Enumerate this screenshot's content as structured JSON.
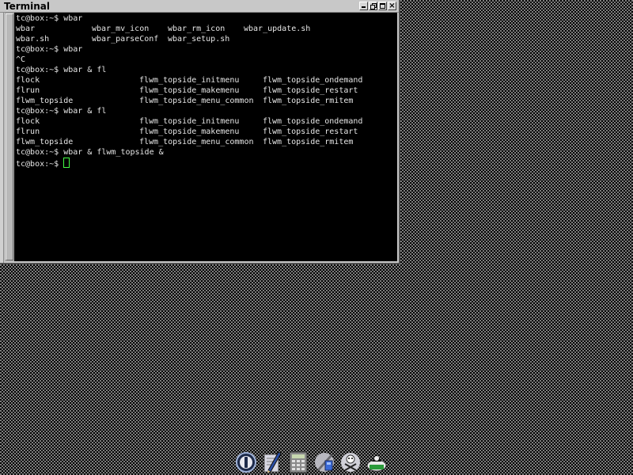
{
  "window": {
    "title": "Terminal",
    "buttons": {
      "minimize": "minimize",
      "maximize": "maximize",
      "restore": "restore",
      "close": "×"
    }
  },
  "terminal": {
    "lines": [
      {
        "type": "text",
        "text": "tc@box:~$ wbar"
      },
      {
        "type": "cols4",
        "c0": "wbar",
        "c1": "wbar_mv_icon",
        "c2": "wbar_rm_icon",
        "c3": "wbar_update.sh"
      },
      {
        "type": "cols3",
        "c0": "wbar.sh",
        "c1": "wbar_parseConf",
        "c2": "wbar_setup.sh"
      },
      {
        "type": "text",
        "text": "tc@box:~$ wbar"
      },
      {
        "type": "text",
        "text": "^C"
      },
      {
        "type": "text",
        "text": "tc@box:~$ wbar & fl"
      },
      {
        "type": "cols3w",
        "c0": "flock",
        "c1": "flwm_topside_initmenu",
        "c2": "flwm_topside_ondemand"
      },
      {
        "type": "cols3w",
        "c0": "flrun",
        "c1": "flwm_topside_makemenu",
        "c2": "flwm_topside_restart"
      },
      {
        "type": "cols3w",
        "c0": "flwm_topside",
        "c1": "flwm_topside_menu_common",
        "c2": "flwm_topside_rmitem"
      },
      {
        "type": "text",
        "text": "tc@box:~$ wbar & fl"
      },
      {
        "type": "cols3w",
        "c0": "flock",
        "c1": "flwm_topside_initmenu",
        "c2": "flwm_topside_ondemand"
      },
      {
        "type": "cols3w",
        "c0": "flrun",
        "c1": "flwm_topside_makemenu",
        "c2": "flwm_topside_restart"
      },
      {
        "type": "cols3w",
        "c0": "flwm_topside",
        "c1": "flwm_topside_menu_common",
        "c2": "flwm_topside_rmitem"
      },
      {
        "type": "text",
        "text": "tc@box:~$ wbar & flwm_topside &"
      },
      {
        "type": "prompt",
        "text": "tc@box:~$ "
      }
    ],
    "colors": {
      "background": "#000000",
      "foreground": "#e6e6e6",
      "cursor": "#44ff44"
    }
  },
  "dock": {
    "items": [
      {
        "name": "power-icon"
      },
      {
        "name": "editor-icon"
      },
      {
        "name": "calculator-icon"
      },
      {
        "name": "control-panel-icon"
      },
      {
        "name": "apps-icon"
      },
      {
        "name": "mount-tool-icon"
      }
    ]
  }
}
